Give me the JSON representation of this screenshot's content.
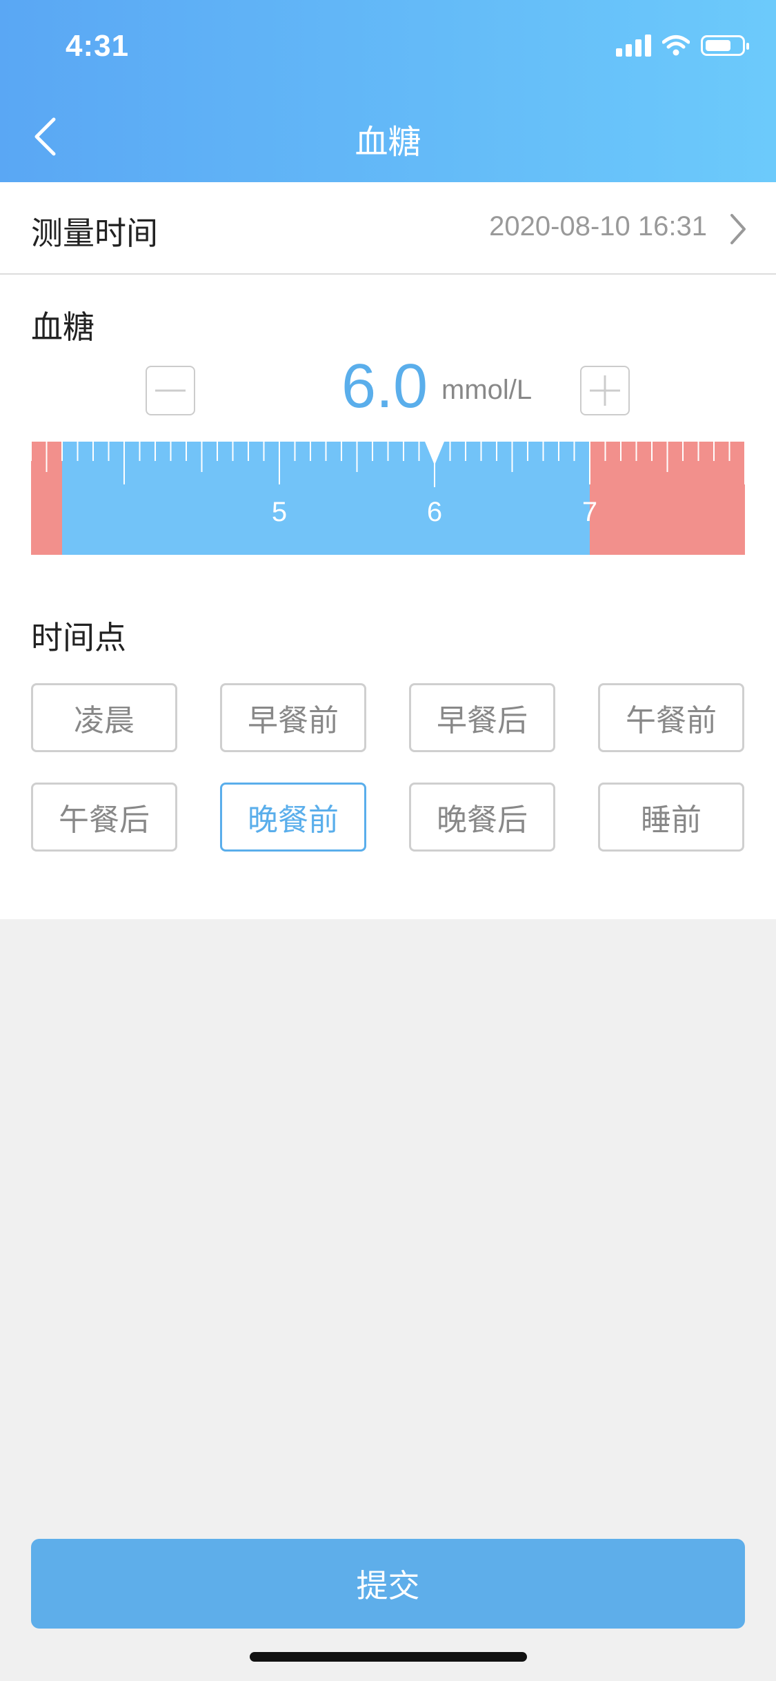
{
  "status_bar": {
    "time": "4:31"
  },
  "header": {
    "title": "血糖"
  },
  "measure_time": {
    "label": "测量时间",
    "value": "2020-08-10 16:31"
  },
  "glucose": {
    "label": "血糖",
    "value": "6.0",
    "unit": "mmol/L",
    "ruler": {
      "view_min": 3.4,
      "view_max": 8.0,
      "normal_min": 3.6,
      "normal_max": 7.0,
      "current": 6.0,
      "major_labels": [
        "5",
        "6",
        "7"
      ],
      "normal_color": "#72c3f8",
      "abnormal_color": "#f2908c"
    }
  },
  "time_point": {
    "label": "时间点",
    "options": [
      "凌晨",
      "早餐前",
      "早餐后",
      "午餐前",
      "午餐后",
      "晚餐前",
      "晚餐后",
      "睡前"
    ],
    "selected": "晚餐前"
  },
  "submit_label": "提交",
  "colors": {
    "accent": "#5aaeeb",
    "header_start": "#5aa7f4",
    "header_end": "#6ccafb"
  }
}
